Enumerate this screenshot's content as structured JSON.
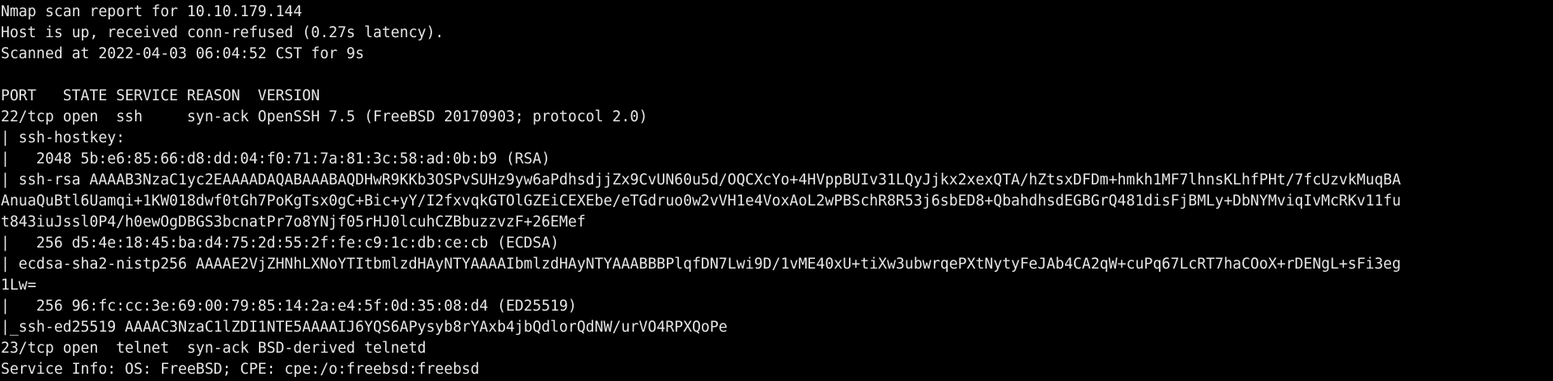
{
  "terminal": {
    "lines": [
      "Nmap scan report for 10.10.179.144",
      "Host is up, received conn-refused (0.27s latency).",
      "Scanned at 2022-04-03 06:04:52 CST for 9s",
      "",
      "PORT   STATE SERVICE REASON  VERSION",
      "22/tcp open  ssh     syn-ack OpenSSH 7.5 (FreeBSD 20170903; protocol 2.0)",
      "| ssh-hostkey:",
      "|   2048 5b:e6:85:66:d8:dd:04:f0:71:7a:81:3c:58:ad:0b:b9 (RSA)",
      "| ssh-rsa AAAAB3NzaC1yc2EAAAADAQABAAABAQDHwR9KKb3OSPvSUHz9yw6aPdhsdjjZx9CvUN60u5d/OQCXcYo+4HVppBUIv31LQyJjkx2xexQTA/hZtsxDFDm+hmkh1MF7lhnsKLhfPHt/7fcUzvkMuqBA",
      "AnuaQuBtl6Uamqi+1KW018dwf0tGh7PoKgTsx0gC+Bic+yY/I2fxvqkGTOlGZEiCEXEbe/eTGdruo0w2vVH1e4VoxAoL2wPBSchR8R53j6sbED8+QbahdhsdEGBGrQ481disFjBMLy+DbNYMviqIvMcRKv11fu",
      "t843iuJssl0P4/h0ewOgDBGS3bcnatPr7o8YNjf05rHJ0lcuhCZBbuzzvzF+26EMef",
      "|   256 d5:4e:18:45:ba:d4:75:2d:55:2f:fe:c9:1c:db:ce:cb (ECDSA)",
      "| ecdsa-sha2-nistp256 AAAAE2VjZHNhLXNoYTItbmlzdHAyNTYAAAAIbmlzdHAyNTYAAABBBPlqfDN7Lwi9D/1vME40xU+tiXw3ubwrqePXtNytyFeJAb4CA2qW+cuPq67LcRT7haCOoX+rDENgL+sFi3eg",
      "1Lw=",
      "|   256 96:fc:cc:3e:69:00:79:85:14:2a:e4:5f:0d:35:08:d4 (ED25519)",
      "|_ssh-ed25519 AAAAC3NzaC1lZDI1NTE5AAAAIJ6YQS6APysyb8rYAxb4jbQdlorQdNW/urVO4RPXQoPe",
      "23/tcp open  telnet  syn-ack BSD-derived telnetd",
      "Service Info: OS: FreeBSD; CPE: cpe:/o:freebsd:freebsd"
    ]
  },
  "colors": {
    "background": "#000000",
    "foreground": "#e6e6e6"
  }
}
